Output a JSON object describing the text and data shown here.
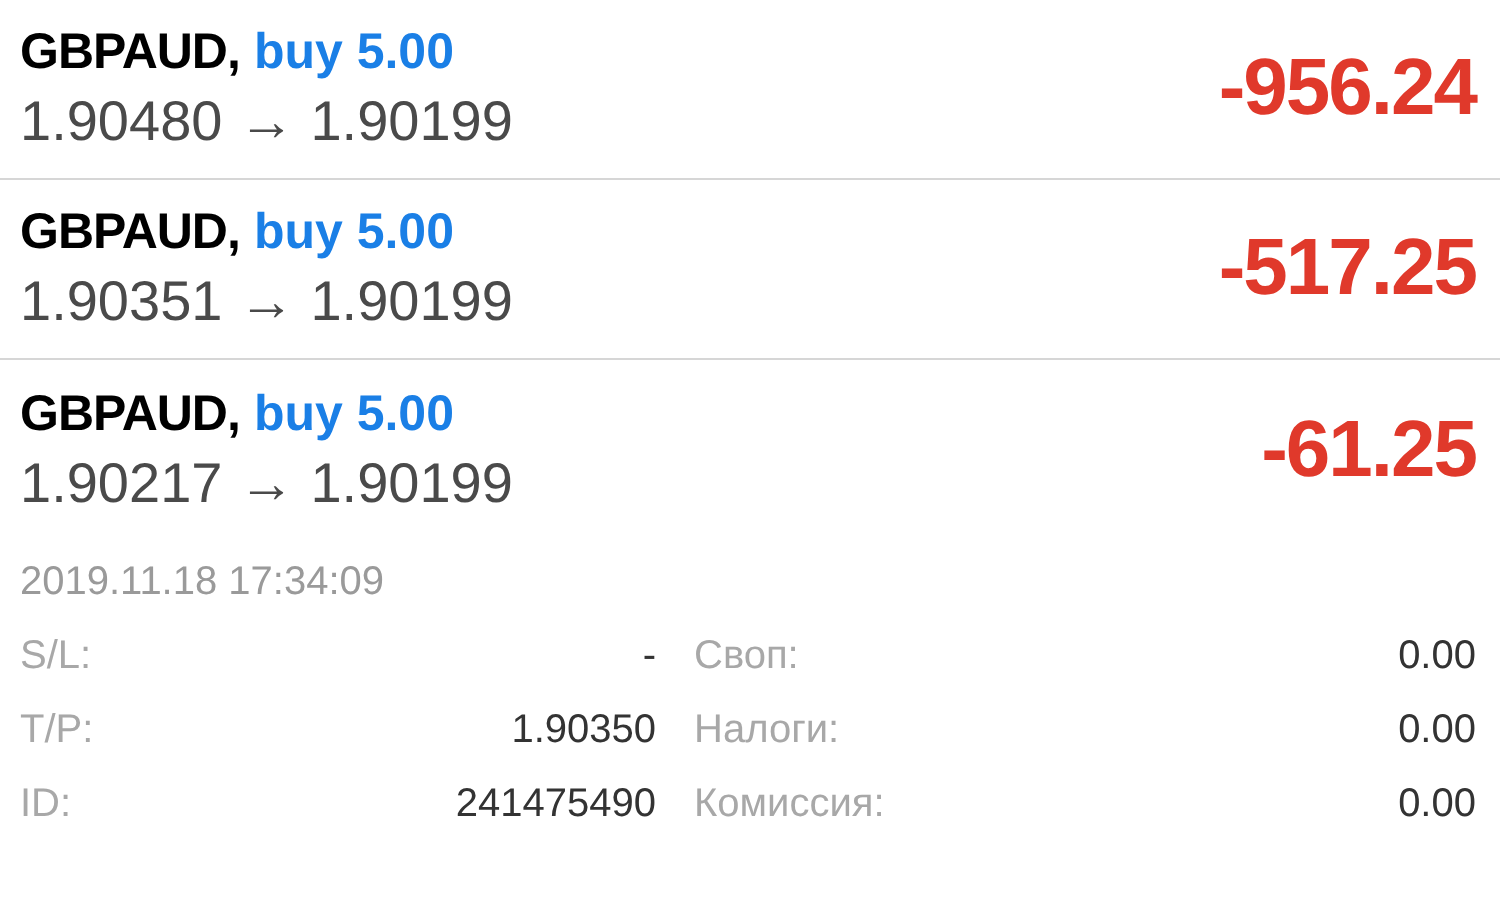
{
  "positions": [
    {
      "symbol": "GBPAUD,",
      "side": "buy 5.00",
      "open_price": "1.90480",
      "arrow": "→",
      "current_price": "1.90199",
      "profit": "-956.24"
    },
    {
      "symbol": "GBPAUD,",
      "side": "buy 5.00",
      "open_price": "1.90351",
      "arrow": "→",
      "current_price": "1.90199",
      "profit": "-517.25"
    },
    {
      "symbol": "GBPAUD,",
      "side": "buy 5.00",
      "open_price": "1.90217",
      "arrow": "→",
      "current_price": "1.90199",
      "profit": "-61.25"
    }
  ],
  "details": {
    "time": "2019.11.18 17:34:09",
    "rows": [
      {
        "label": "S/L:",
        "value": "-",
        "label_2": "Своп:",
        "value_2": "0.00"
      },
      {
        "label": "T/P:",
        "value": "1.90350",
        "label_2": "Налоги:",
        "value_2": "0.00"
      },
      {
        "label": "ID:",
        "value": "241475490",
        "label_2": "Комиссия:",
        "value_2": "0.00"
      }
    ]
  }
}
